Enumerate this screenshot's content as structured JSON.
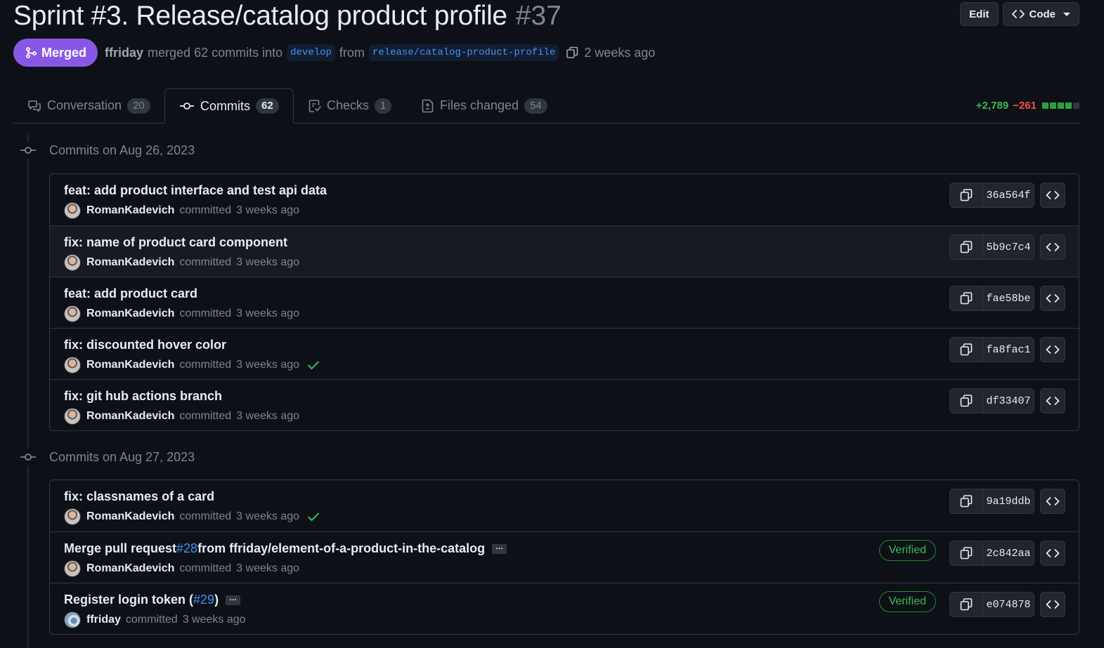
{
  "header": {
    "title": "Sprint #3. Release/catalog product profile",
    "number": "#37",
    "edit_label": "Edit",
    "code_label": "Code"
  },
  "status": {
    "badge": "Merged",
    "user": "ffriday",
    "merged_text": "merged 62 commits into",
    "base_branch": "develop",
    "from_text": "from",
    "head_branch": "release/catalog-product-profile",
    "time": "2 weeks ago"
  },
  "tabs": [
    {
      "label": "Conversation",
      "count": "20",
      "icon": "comment-icon"
    },
    {
      "label": "Commits",
      "count": "62",
      "icon": "commit-icon",
      "active": true
    },
    {
      "label": "Checks",
      "count": "1",
      "icon": "checklist-icon"
    },
    {
      "label": "Files changed",
      "count": "54",
      "icon": "file-diff-icon"
    }
  ],
  "diffstat": {
    "additions": "+2,789",
    "deletions": "−261",
    "blocks": [
      "green",
      "green",
      "green",
      "green",
      "gray"
    ],
    "colors": {
      "green": "#2ea043",
      "gray": "#30363d"
    }
  },
  "colors": {
    "merged": "#8957e5",
    "link": "#4493f8",
    "success": "#3fb950"
  },
  "groups": [
    {
      "date": "Commits on Aug 26, 2023",
      "commits": [
        {
          "message": "feat: add product interface and test api data",
          "author": "RomanKadevich",
          "action": "committed",
          "time": "3 weeks ago",
          "sha": "36a564f",
          "check": false
        },
        {
          "message": "fix: name of product card component",
          "author": "RomanKadevich",
          "action": "committed",
          "time": "3 weeks ago",
          "sha": "5b9c7c4",
          "check": false
        },
        {
          "message": "feat: add product card",
          "author": "RomanKadevich",
          "action": "committed",
          "time": "3 weeks ago",
          "sha": "fae58be",
          "check": false
        },
        {
          "message": "fix: discounted hover color",
          "author": "RomanKadevich",
          "action": "committed",
          "time": "3 weeks ago",
          "sha": "fa8fac1",
          "check": true
        },
        {
          "message": "fix: git hub actions branch",
          "author": "RomanKadevich",
          "action": "committed",
          "time": "3 weeks ago",
          "sha": "df33407",
          "check": false
        }
      ]
    },
    {
      "date": "Commits on Aug 27, 2023",
      "commits": [
        {
          "message": "fix: classnames of a card",
          "author": "RomanKadevich",
          "action": "committed",
          "time": "3 weeks ago",
          "sha": "9a19ddb",
          "check": true
        },
        {
          "message_prefix": "Merge pull request",
          "link": "#28",
          "message_suffix": "from ffriday/element-of-a-product-in-the-catalog",
          "ellipsis": "…",
          "author": "RomanKadevich",
          "action": "committed",
          "time": "3 weeks ago",
          "sha": "2c842aa",
          "verified": "Verified"
        },
        {
          "message_prefix": "Register login token (",
          "link": "#29",
          "message_suffix": ")",
          "ellipsis": "…",
          "author": "ffriday",
          "action": "committed",
          "time": "3 weeks ago",
          "sha": "e074878",
          "verified": "Verified"
        }
      ]
    }
  ]
}
